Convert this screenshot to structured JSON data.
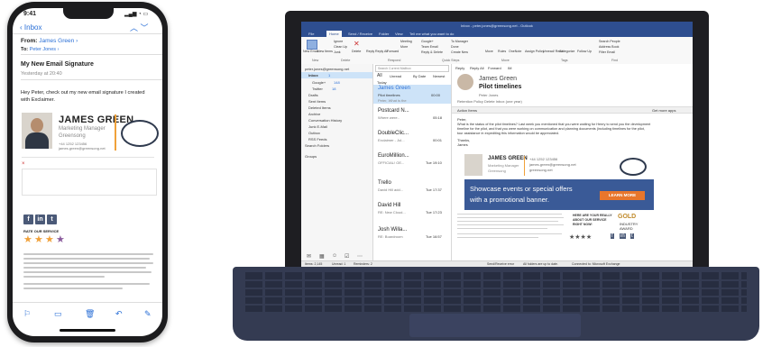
{
  "phone": {
    "status_time": "9:41",
    "nav": {
      "back_label": "Inbox"
    },
    "email": {
      "from_label": "From:",
      "from_name": "James Green",
      "to_label": "To:",
      "to_name": "Peter Jones",
      "subject": "My New Email Signature",
      "date": "Yesterday at 20:40",
      "body_line1": "Hey Peter, check out my new email signature I created",
      "body_line2": "with Exclaimer."
    },
    "signature": {
      "name": "JAMES GREEN",
      "title": "Marketing Manager",
      "company": "Greensong",
      "phone_line": "+44 1252 123456",
      "email_line": "james.green@greensong.net",
      "rate_label": "RATE OUR SERVICE",
      "social": [
        "f",
        "in",
        "t"
      ]
    },
    "toolbar_icons": [
      "flag-icon",
      "folder-icon",
      "trash-icon",
      "reply-icon",
      "compose-icon"
    ]
  },
  "laptop": {
    "title_bar": "Inbox - peter.jones@greensong.net - Outlook",
    "tabs": [
      "File",
      "Home",
      "Send / Receive",
      "Folder",
      "View",
      "Tell me what you want to do"
    ],
    "ribbon": {
      "groups": [
        "New",
        "Delete",
        "Respond",
        "Quick Steps",
        "Move",
        "Tags",
        "Find"
      ],
      "new_email": "New Email",
      "new_items": "New Items",
      "ignore": "Ignore",
      "clean_up": "Clean Up",
      "junk": "Junk",
      "delete": "Delete",
      "reply": "Reply",
      "reply_all": "Reply All",
      "forward": "Forward",
      "meeting": "Meeting",
      "more": "More",
      "google": "Google+",
      "team_email": "Team Email",
      "reply_delete": "Reply & Delete",
      "to_manager": "To Manager",
      "done": "Done",
      "create_new": "Create New",
      "move": "Move",
      "rules": "Rules",
      "onenote": "OneNote",
      "assign_policy": "Assign Policy",
      "unread_read": "Unread/ Read",
      "categorize": "Categorize",
      "follow_up": "Follow Up",
      "search_people": "Search People",
      "address_book": "Address Book",
      "filter_email": "Filter Email"
    },
    "nav_pane": {
      "account": "peter.jones@greensong.net",
      "folders": [
        {
          "name": "Inbox",
          "count": "1",
          "selected": true
        },
        {
          "name": "Google+",
          "count": "148",
          "selected": false
        },
        {
          "name": "Twitter",
          "count": "18",
          "selected": false
        },
        {
          "name": "Drafts",
          "count": "",
          "selected": false
        },
        {
          "name": "Sent Items",
          "count": "",
          "selected": false
        },
        {
          "name": "Deleted Items",
          "count": "",
          "selected": false
        },
        {
          "name": "Archive",
          "count": "",
          "selected": false
        },
        {
          "name": "Conversation History",
          "count": "",
          "selected": false
        },
        {
          "name": "Junk E-Mail",
          "count": "",
          "selected": false
        },
        {
          "name": "Outbox",
          "count": "",
          "selected": false
        },
        {
          "name": "RSS Feeds",
          "count": "",
          "selected": false
        },
        {
          "name": "Search Folders",
          "count": "",
          "selected": false
        }
      ],
      "groups_label": "Groups"
    },
    "message_list": {
      "search_placeholder": "Search Current Mailbox",
      "filter_all": "All",
      "filter_unread": "Unread",
      "sort_by": "By Date",
      "sort_order": "Newest",
      "section": "Today",
      "items": [
        {
          "sender": "James Green",
          "subject": "Pilot timelines",
          "preview": "Peter, What is the",
          "time": "00:00",
          "selected": true
        },
        {
          "sender": "Postcard N...",
          "subject": "Where were..",
          "preview": "",
          "time": "05:18",
          "selected": false
        },
        {
          "sender": "DoubleClic...",
          "subject": "Exclaimer - Jul...",
          "preview": "",
          "time": "00:01",
          "selected": false
        },
        {
          "sender": "EuroMillion...",
          "subject": "OFFICIAL! OE...",
          "preview": "",
          "time": "Tue 19:10",
          "selected": false
        },
        {
          "sender": "Trello",
          "subject": "David Hill add...",
          "preview": "",
          "time": "Tue 17:37",
          "selected": false
        },
        {
          "sender": "David Hill",
          "subject": "RE: New Cloud...",
          "preview": "",
          "time": "Tue 17:23",
          "selected": false
        },
        {
          "sender": "Josh Willa...",
          "subject": "RE: Boardroom",
          "preview": "",
          "time": "Tue 16:57",
          "selected": false
        }
      ]
    },
    "reading_pane": {
      "actions": [
        "Reply",
        "Reply All",
        "Forward",
        "IM"
      ],
      "sender": "James Green",
      "subject": "Pilot timelines",
      "to": "Peter Jones",
      "retention": "Retention Policy   Delete Inbox (one year)",
      "action_items": "Action Items",
      "get_more_apps": "Get more apps",
      "greeting": "Peter,",
      "body": [
        "What is the status of the pilot timelines? Last week you mentioned that you were waiting for Henry to send you the development",
        "timeline for the pilot, and that you were working on communication and planning documents (including timelines for the pilot,",
        "tour assistance in expediting this information would be appreciated."
      ],
      "sign_off": "Thanks,",
      "sign_name": "James",
      "sig_name": "JAMES GREEN",
      "sig_title": "Marketing Manager",
      "sig_company": "Greensong",
      "sig_phone": "+44 1252 123456",
      "sig_email": "james.green@greensong.net",
      "sig_web": "greensong.net",
      "banner_line1": "Showcase events or special offers",
      "banner_line2": "with a promotional banner.",
      "learn_more": "LEARN MORE",
      "award_line1": "HERE ARE YOUR REALLY",
      "award_line2": "ABOUT OUR SERVICE",
      "award_line3": "RIGHT NOW!",
      "award_gold": "GOLD",
      "award_industry": "INDUSTRY",
      "award_award": "AWARD"
    },
    "status_bar": {
      "items": "Items: 2,145",
      "unread": "Unread: 1",
      "reminders": "Reminders: 2",
      "send_receive": "Send/Receive error",
      "folders": "All folders are up to date.",
      "connected": "Connected to: Microsoft Exchange"
    }
  },
  "colors": {
    "outlook_blue": "#2e4e8f",
    "banner_blue": "#3a5a97",
    "orange": "#e8762c",
    "link_blue": "#2a6fd6"
  }
}
